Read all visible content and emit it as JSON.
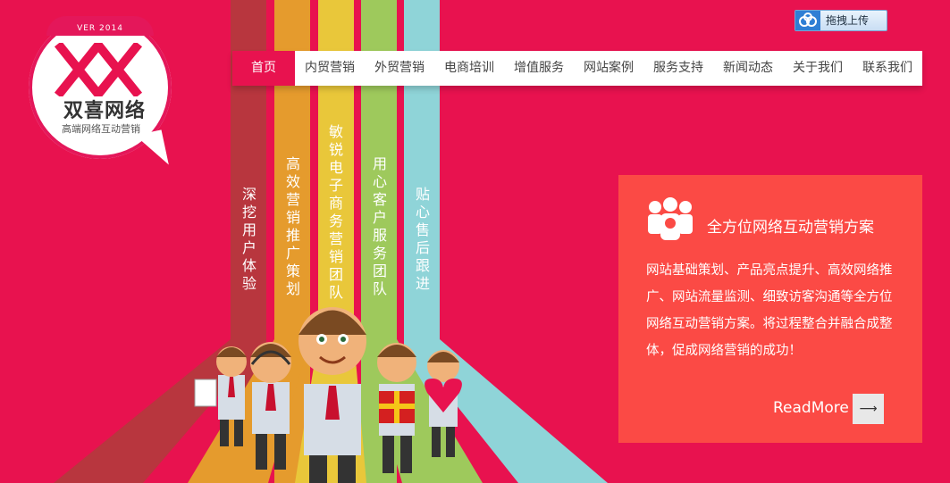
{
  "logo": {
    "version": "VER 2014",
    "name": "双喜网络",
    "tagline": "高端网络互动营销"
  },
  "upload": {
    "label": "拖拽上传",
    "icon": "cloud-icon"
  },
  "nav": {
    "home": "首页",
    "items": [
      "内贸营销",
      "外贸营销",
      "电商培训",
      "增值服务",
      "网站案例",
      "服务支持",
      "新闻动态",
      "关于我们",
      "联系我们"
    ]
  },
  "stripes": [
    "深挖用户体验",
    "高效营销推广策划",
    "敏锐电子商务营销团队",
    "用心客户服务团队",
    "贴心售后跟进"
  ],
  "info": {
    "icon": "team-icon",
    "title": "全方位网络互动营销方案",
    "body": "网站基础策划、产品亮点提升、高效网络推广、网站流量监测、细致访客沟通等全方位网络互动营销方案。将过程整合并融合成整体，促成网络营销的成功！",
    "readmore": "ReadMore",
    "arrow": "⟶"
  },
  "colors": {
    "background": "#e8124f",
    "panel": "#fb4a45"
  }
}
